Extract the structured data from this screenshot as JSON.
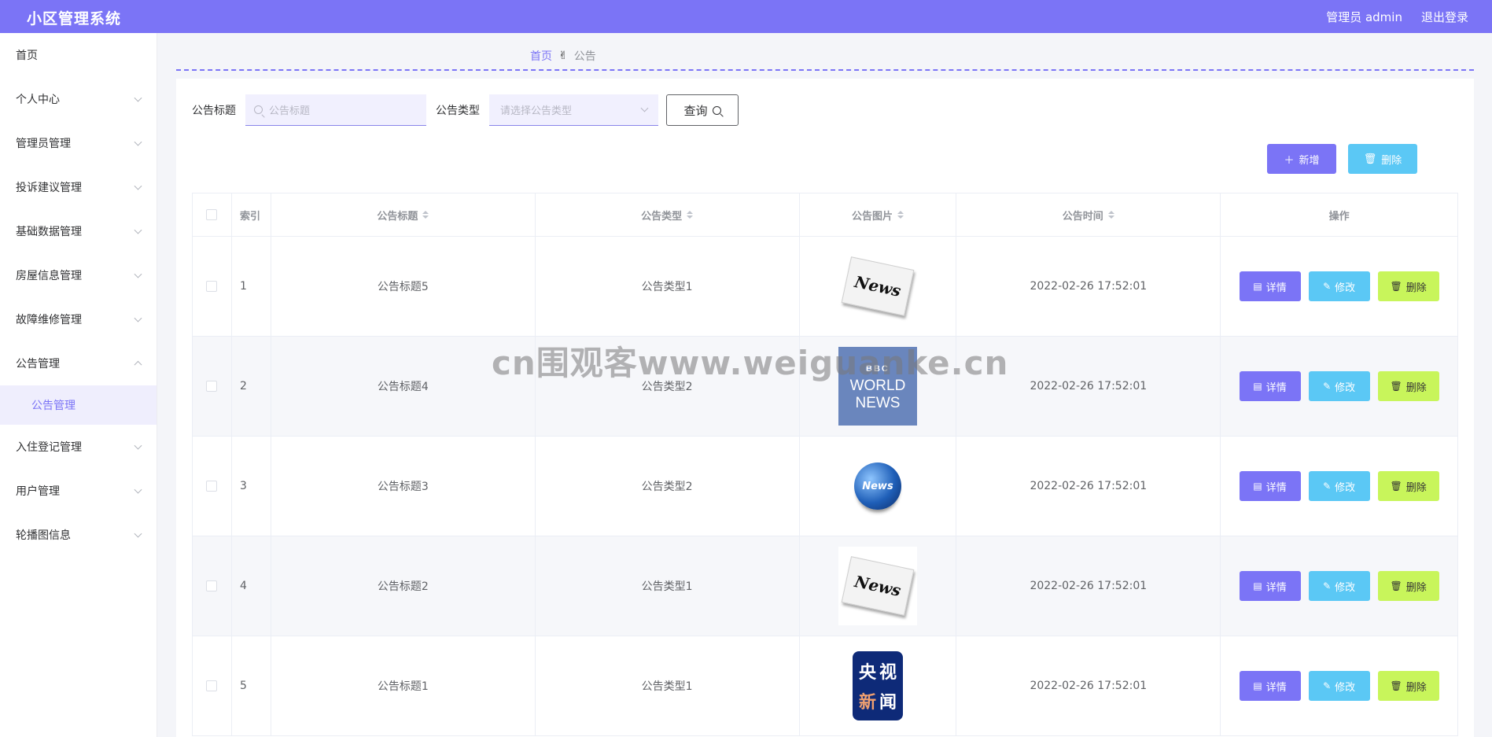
{
  "header": {
    "app_title": "小区管理系统",
    "user_label": "管理员 admin",
    "logout_label": "退出登录"
  },
  "sidebar": {
    "items": [
      {
        "label": "首页",
        "has_chevron": false
      },
      {
        "label": "个人中心",
        "has_chevron": true
      },
      {
        "label": "管理员管理",
        "has_chevron": true
      },
      {
        "label": "投诉建议管理",
        "has_chevron": true
      },
      {
        "label": "基础数据管理",
        "has_chevron": true
      },
      {
        "label": "房屋信息管理",
        "has_chevron": true
      },
      {
        "label": "故障维修管理",
        "has_chevron": true
      },
      {
        "label": "公告管理",
        "has_chevron": true,
        "expanded": true
      },
      {
        "label": "入住登记管理",
        "has_chevron": true
      },
      {
        "label": "用户管理",
        "has_chevron": true
      },
      {
        "label": "轮播图信息",
        "has_chevron": true
      }
    ],
    "active_sub": "公告管理"
  },
  "breadcrumb": {
    "home": "首页",
    "separator_icon": "hand-icon",
    "current": "公告"
  },
  "search": {
    "title_label": "公告标题",
    "title_placeholder": "公告标题",
    "type_label": "公告类型",
    "type_placeholder": "请选择公告类型",
    "query_label": "查询"
  },
  "actions": {
    "add_label": "新增",
    "delete_label": "删除"
  },
  "table": {
    "columns": [
      "索引",
      "公告标题",
      "公告类型",
      "公告图片",
      "公告时间",
      "操作"
    ],
    "rows": [
      {
        "index": "1",
        "title": "公告标题5",
        "type": "公告类型1",
        "image": "news-paper",
        "time": "2022-02-26 17:52:01"
      },
      {
        "index": "2",
        "title": "公告标题4",
        "type": "公告类型2",
        "image": "bbc-world-news",
        "time": "2022-02-26 17:52:01"
      },
      {
        "index": "3",
        "title": "公告标题3",
        "type": "公告类型2",
        "image": "news-globe",
        "time": "2022-02-26 17:52:01"
      },
      {
        "index": "4",
        "title": "公告标题2",
        "type": "公告类型1",
        "image": "news-paper",
        "time": "2022-02-26 17:52:01"
      },
      {
        "index": "5",
        "title": "公告标题1",
        "type": "公告类型1",
        "image": "cctv-news",
        "time": "2022-02-26 17:52:01"
      }
    ],
    "row_buttons": {
      "detail": "详情",
      "edit": "修改",
      "delete": "删除"
    }
  },
  "thumb_text": {
    "news": "News",
    "bbc": "BBC",
    "world": "WORLD",
    "news_caps": "NEWS",
    "cctv": [
      "央",
      "视",
      "新",
      "闻"
    ]
  },
  "watermark": "cn围观客www.weiguanke.cn",
  "colors": {
    "primary": "#7b74f6",
    "info": "#5bc8f5",
    "warning": "#c8f55b"
  }
}
